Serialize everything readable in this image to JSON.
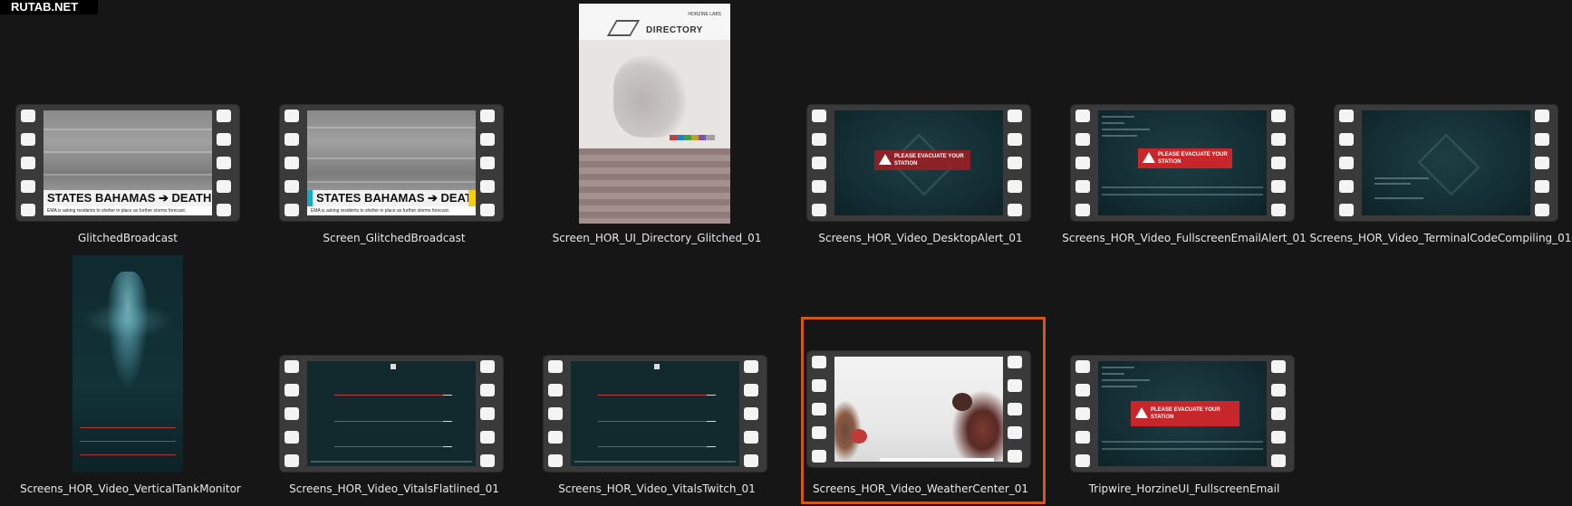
{
  "watermark": "RUTAB.NET",
  "items": [
    {
      "label": "GlitchedBroadcast",
      "ticker": "STATES BAHAMAS ➔ DEATH TOL",
      "subtext": "EMA is asking residents to shelter in place as further storms forecast."
    },
    {
      "label": "Screen_GlitchedBroadcast",
      "ticker": "STATES BAHAMAS ➔ DEATH TO",
      "subtext": "EMA is asking residents to shelter in place as further storms forecast."
    },
    {
      "label": "Screen_HOR_UI_Directory_Glitched_01",
      "brand": "HORZINE LABS",
      "heading": "DIRECTORY"
    },
    {
      "label": "Screens_HOR_Video_DesktopAlert_01",
      "alert_title": "PLEASE EVACUATE YOUR STATION"
    },
    {
      "label": "Screens_HOR_Video_FullscreenEmailAlert_01",
      "alert_title": "PLEASE EVACUATE YOUR STATION"
    },
    {
      "label": "Screens_HOR_Video_TerminalCodeCompiling_01"
    },
    {
      "label": "Screens_HOR_Video_VerticalTankMonitor"
    },
    {
      "label": "Screens_HOR_Video_VitalsFlatlined_01"
    },
    {
      "label": "Screens_HOR_Video_VitalsTwitch_01"
    },
    {
      "label": "Screens_HOR_Video_WeatherCenter_01",
      "selected": true
    },
    {
      "label": "Tripwire_HorzineUI_FullscreenEmail",
      "alert_title": "PLEASE EVACUATE YOUR STATION"
    }
  ],
  "colors": {
    "background": "#161616",
    "selection": "#d4571a",
    "alert_red": "#c7262a",
    "teal": "#143036"
  }
}
